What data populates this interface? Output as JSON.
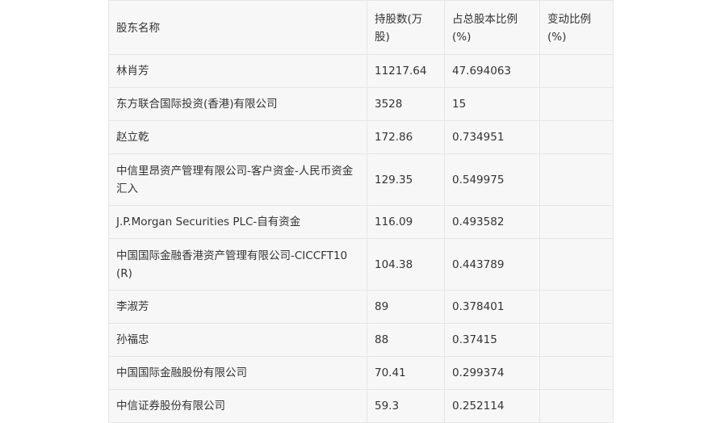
{
  "table": {
    "headers": [
      "股东名称",
      "持股数(万股)",
      "占总股本比例(%)",
      "变动比例(%)"
    ],
    "rows": [
      {
        "name": "林肖芳",
        "shares": "11217.64",
        "ratio": "47.694063",
        "change": ""
      },
      {
        "name": "东方联合国际投资(香港)有限公司",
        "shares": "3528",
        "ratio": "15",
        "change": ""
      },
      {
        "name": "赵立乾",
        "shares": "172.86",
        "ratio": "0.734951",
        "change": ""
      },
      {
        "name": "中信里昂资产管理有限公司-客户资金-人民币资金汇入",
        "shares": "129.35",
        "ratio": "0.549975",
        "change": ""
      },
      {
        "name": "J.P.Morgan Securities PLC-自有资金",
        "shares": "116.09",
        "ratio": "0.493582",
        "change": ""
      },
      {
        "name": "中国国际金融香港资产管理有限公司-CICCFT10(R)",
        "shares": "104.38",
        "ratio": "0.443789",
        "change": ""
      },
      {
        "name": "李淑芳",
        "shares": "89",
        "ratio": "0.378401",
        "change": ""
      },
      {
        "name": "孙福忠",
        "shares": "88",
        "ratio": "0.37415",
        "change": ""
      },
      {
        "name": "中国国际金融股份有限公司",
        "shares": "70.41",
        "ratio": "0.299374",
        "change": ""
      },
      {
        "name": "中信证券股份有限公司",
        "shares": "59.3",
        "ratio": "0.252114",
        "change": ""
      }
    ]
  }
}
